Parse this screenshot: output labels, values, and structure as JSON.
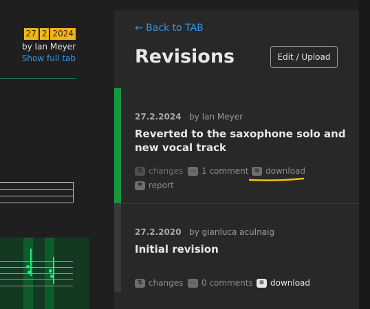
{
  "left": {
    "date_badges": [
      "27",
      "2",
      "2024"
    ],
    "author": "by Ian Meyer",
    "show_full_tab": "Show full tab"
  },
  "panel": {
    "back_link": "← Back to TAB",
    "title": "Revisions",
    "edit_button": "Edit / Upload",
    "revisions": [
      {
        "date": "27.2.2024",
        "author": "by Ian Meyer",
        "title": "Reverted to the saxophone solo and new vocal track",
        "changes": "changes",
        "comments": "1 comment",
        "download": "download",
        "report": "report",
        "status": "active"
      },
      {
        "date": "27.2.2020",
        "author": "by gianluca aculnaig",
        "title": "Initial revision",
        "changes": "changes",
        "comments": "0 comments",
        "download": "download"
      }
    ]
  },
  "colors": {
    "accent_link": "#3a95e0",
    "active_bar": "#17963e",
    "badge": "#f2b61b",
    "highlight": "#f2c40f"
  },
  "icons": {
    "changes": "swap-arrows-icon",
    "comments": "comment-bubble-icon",
    "download": "download-stack-icon",
    "report": "flag-icon"
  }
}
